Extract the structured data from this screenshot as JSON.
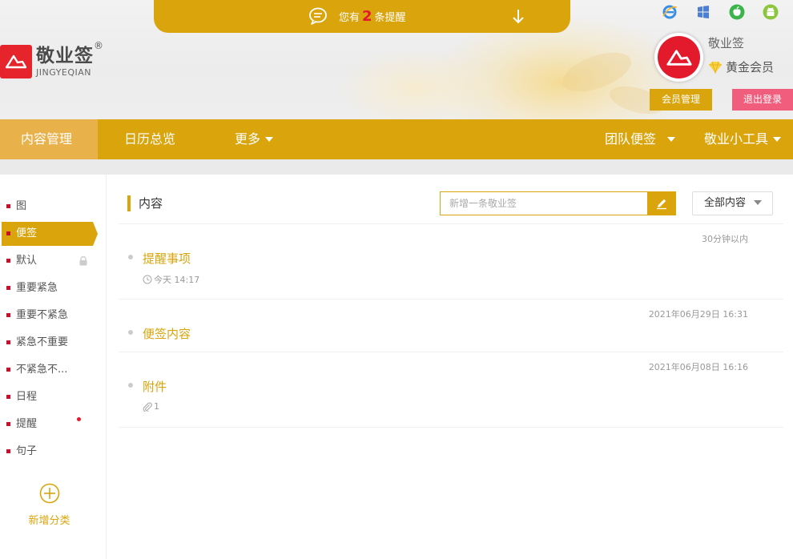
{
  "colors": {
    "accent": "#d9a40c",
    "brand_red": "#e3192c",
    "logout": "#f05d7d"
  },
  "brand": {
    "name_cn": "敬业签",
    "name_en": "JINGYEQIAN",
    "registered": "®"
  },
  "reminder": {
    "prefix": "您有",
    "count": "2",
    "suffix": "条提醒"
  },
  "platforms": [
    "ie-icon",
    "windows-icon",
    "apple-icon",
    "android-icon"
  ],
  "user": {
    "name": "敬业签",
    "level": "黄金会员",
    "member_btn": "会员管理",
    "logout_btn": "退出登录"
  },
  "nav": {
    "items": [
      "内容管理",
      "日历总览",
      "更多"
    ],
    "right": [
      "团队便签",
      "敬业小工具"
    ]
  },
  "sidebar": {
    "items": [
      {
        "label": "图"
      },
      {
        "label": "便签"
      },
      {
        "label": "默认"
      },
      {
        "label": "重要紧急"
      },
      {
        "label": "重要不紧急"
      },
      {
        "label": "紧急不重要"
      },
      {
        "label": "不紧急不..."
      },
      {
        "label": "日程"
      },
      {
        "label": "提醒"
      },
      {
        "label": "句子"
      }
    ],
    "add_label": "新增分类"
  },
  "main": {
    "title": "内容",
    "search_placeholder": "新增一条敬业签",
    "filter": "全部内容",
    "notes": [
      {
        "time": "30分钟以内",
        "title": "提醒事项",
        "meta": "今天 14:17"
      },
      {
        "time": "2021年06月29日 16:31",
        "title": "便签内容"
      },
      {
        "time": "2021年06月08日 16:16",
        "title": "附件",
        "meta": "1"
      }
    ]
  }
}
